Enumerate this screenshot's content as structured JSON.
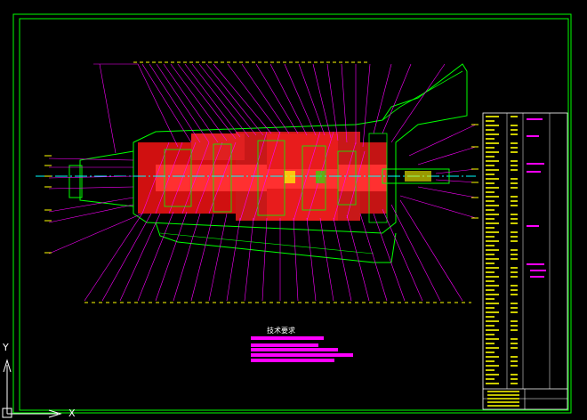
{
  "drawing": {
    "notes_title": "技术要求",
    "ucs": {
      "x_label": "X",
      "y_label": "Y"
    },
    "colors": {
      "background": "#000000",
      "frame": "#00ff00",
      "leaders": "#ff00ff",
      "section_fill": "#ff2020",
      "hatch": "#ff00ff",
      "title_block": "#ffff00",
      "centerline": "#00ffff",
      "notes_bar": "#ff00ff",
      "ucs": "#ffffff"
    },
    "icons": [
      "ucs-axis-icon"
    ]
  }
}
